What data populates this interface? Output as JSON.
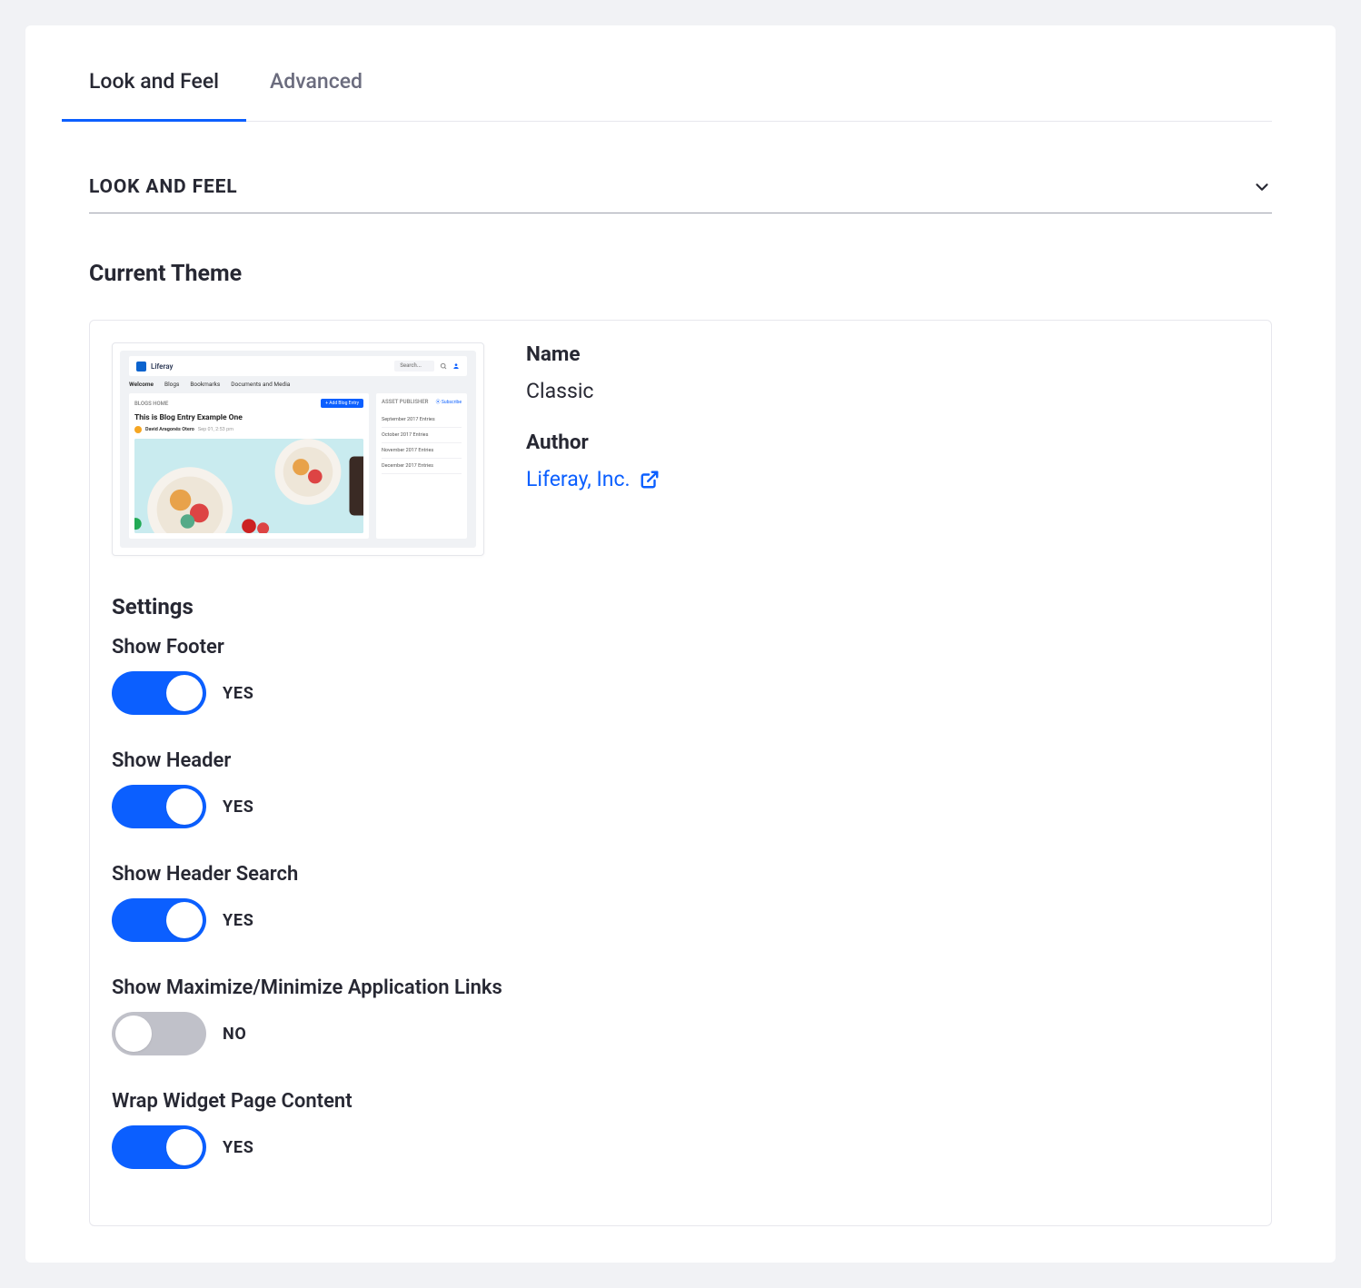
{
  "tabs": {
    "look_and_feel": "Look and Feel",
    "advanced": "Advanced"
  },
  "section": {
    "title": "LOOK AND FEEL"
  },
  "current_theme": {
    "heading": "Current Theme",
    "name_label": "Name",
    "name_value": "Classic",
    "author_label": "Author",
    "author_value": "Liferay, Inc."
  },
  "thumbnail": {
    "brand": "Liferay",
    "search_placeholder": "Search...",
    "nav": [
      "Welcome",
      "Blogs",
      "Bookmarks",
      "Documents and Media"
    ],
    "blogs_home": "BLOGS HOME",
    "add_blog": "+ Add Blog Entry",
    "entry_title": "This is Blog Entry Example One",
    "entry_author": "David Aragonés Otero",
    "entry_date": "Sep 01, 2:53 pm",
    "asset_publisher": "ASSET PUBLISHER",
    "subscribe": "Subscribe",
    "archives": [
      "September 2017 Entries",
      "October 2017 Entries",
      "November 2017 Entries",
      "December 2017 Entries"
    ]
  },
  "settings": {
    "heading": "Settings",
    "yes": "YES",
    "no": "NO",
    "items": [
      {
        "label": "Show Footer",
        "on": true
      },
      {
        "label": "Show Header",
        "on": true
      },
      {
        "label": "Show Header Search",
        "on": true
      },
      {
        "label": "Show Maximize/Minimize Application Links",
        "on": false
      },
      {
        "label": "Wrap Widget Page Content",
        "on": true
      }
    ]
  }
}
